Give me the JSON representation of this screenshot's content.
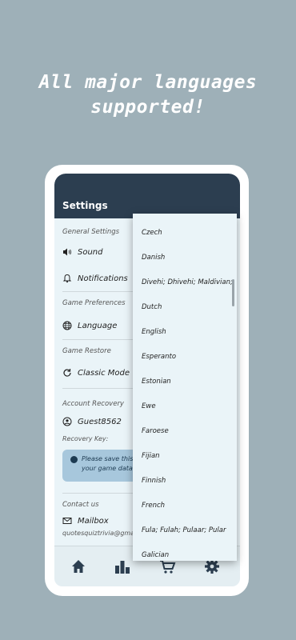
{
  "headline": {
    "line1": "All major languages",
    "line2": "supported!"
  },
  "appbar": {
    "title": "Settings"
  },
  "sections": {
    "general": "General Settings",
    "game_prefs": "Game Preferences",
    "game_restore": "Game Restore",
    "account_recovery": "Account Recovery",
    "contact": "Contact us"
  },
  "rows": {
    "sound": "Sound",
    "notifications": "Notifications",
    "language": "Language",
    "classic_mode": "Classic Mode",
    "guest": "Guest8562",
    "recovery_key": "Recovery Key:",
    "mailbox": "Mailbox",
    "email": "quotesquiztrivia@gmai"
  },
  "notice": {
    "text": "Please save this your game data"
  },
  "dropdown": {
    "items": [
      "Czech",
      "Danish",
      "Divehi; Dhivehi; Maldivian;",
      "Dutch",
      "English",
      "Esperanto",
      "Estonian",
      "Ewe",
      "Faroese",
      "Fijian",
      "Finnish",
      "French",
      "Fula; Fulah; Pulaar; Pular",
      "Galician"
    ]
  },
  "bottom_nav": [
    "home-icon",
    "leaderboard-icon",
    "cart-icon",
    "gear-icon"
  ],
  "colors": {
    "appbar": "#2c3e50",
    "background": "#9eb0b8",
    "screen": "#eaf4f8",
    "notice": "#a7c7dc"
  }
}
